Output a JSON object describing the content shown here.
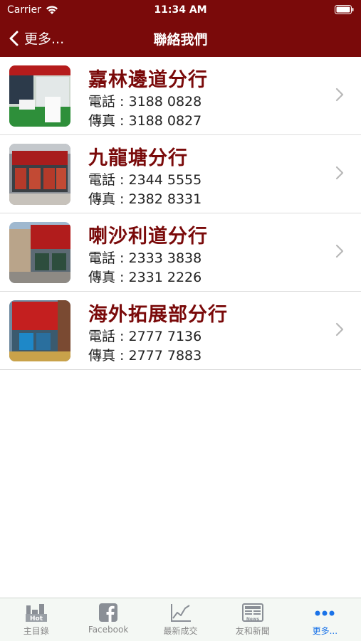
{
  "status": {
    "carrier": "Carrier",
    "time": "11:34 AM"
  },
  "nav": {
    "back_label": "更多...",
    "title": "聯絡我們"
  },
  "branches": [
    {
      "name": "嘉林邊道分行",
      "phone": "電話 : 3188 0828",
      "fax": "傳真 : 3188 0827"
    },
    {
      "name": "九龍塘分行",
      "phone": "電話 : 2344 5555",
      "fax": "傳真 : 2382 8331"
    },
    {
      "name": "喇沙利道分行",
      "phone": "電話 : 2333 3838",
      "fax": "傳真 : 2331 2226"
    },
    {
      "name": "海外拓展部分行",
      "phone": "電話 : 2777 7136",
      "fax": "傳真 : 2777 7883"
    }
  ],
  "tabs": [
    {
      "label": "主目錄",
      "icon": "hot-building-icon"
    },
    {
      "label": "Facebook",
      "icon": "facebook-icon"
    },
    {
      "label": "最新成交",
      "icon": "chart-icon"
    },
    {
      "label": "友和新聞",
      "icon": "news-icon"
    },
    {
      "label": "更多...",
      "icon": "more-dots-icon"
    }
  ],
  "colors": {
    "brand": "#7a0a0a",
    "active_tab": "#1a73e8"
  }
}
